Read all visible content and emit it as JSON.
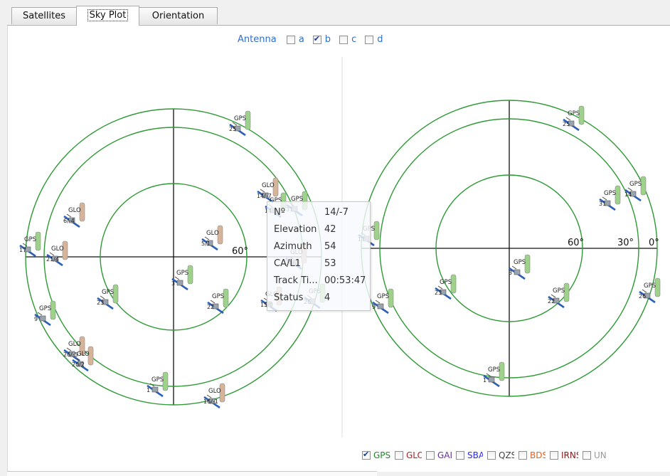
{
  "tabs": [
    {
      "label": "Satellites",
      "active": false
    },
    {
      "label": "Sky Plot",
      "active": true
    },
    {
      "label": "Orientation",
      "active": false
    }
  ],
  "antenna": {
    "label": "Antenna",
    "options": [
      {
        "label": "a",
        "checked": false
      },
      {
        "label": "b",
        "checked": true
      },
      {
        "label": "c",
        "checked": false
      },
      {
        "label": "d",
        "checked": false
      }
    ]
  },
  "plot": {
    "elevation_labels": [
      "60°",
      "30°",
      "0°"
    ],
    "ring_color": "#2e9a35",
    "colors": {
      "GPS": "#9ed18a",
      "GLO": "#d6b49a"
    }
  },
  "left_satellites": [
    {
      "sys": "GPS",
      "id": "25"
    },
    {
      "sys": "GLO",
      "id": "14/-7"
    },
    {
      "sys": "GPS",
      "id": "31"
    },
    {
      "sys": "GPS",
      "id": "14"
    },
    {
      "sys": "GLO",
      "id": "6/-4"
    },
    {
      "sys": "GPS",
      "id": "17"
    },
    {
      "sys": "GLO",
      "id": "21/4"
    },
    {
      "sys": "GLO",
      "id": "5/1"
    },
    {
      "sys": "GLO",
      "id": "30/-3"
    },
    {
      "sys": "GPS",
      "id": "3"
    },
    {
      "sys": "GPS",
      "id": "23"
    },
    {
      "sys": "GPS",
      "id": "22"
    },
    {
      "sys": "GLO",
      "id": "15/0"
    },
    {
      "sys": "GPS",
      "id": "26"
    },
    {
      "sys": "GPS",
      "id": "9"
    },
    {
      "sys": "GLO",
      "id": "26/-5"
    },
    {
      "sys": "GLO",
      "id": "20/2"
    },
    {
      "sys": "GPS",
      "id": "1"
    },
    {
      "sys": "GLO",
      "id": "16/-1"
    }
  ],
  "right_satellites": [
    {
      "sys": "GPS",
      "id": "25"
    },
    {
      "sys": "GPS",
      "id": "31"
    },
    {
      "sys": "GPS",
      "id": "14"
    },
    {
      "sys": "GPS",
      "id": "17"
    },
    {
      "sys": "GPS",
      "id": "3"
    },
    {
      "sys": "GPS",
      "id": "23"
    },
    {
      "sys": "GPS",
      "id": "22"
    },
    {
      "sys": "GPS",
      "id": "9"
    },
    {
      "sys": "GPS",
      "id": "26"
    },
    {
      "sys": "GPS",
      "id": "1"
    }
  ],
  "tooltip": {
    "rows": [
      {
        "key": "Nº",
        "value": "14/-7"
      },
      {
        "key": "Elevation",
        "value": "42"
      },
      {
        "key": "Azimuth",
        "value": "54"
      },
      {
        "key": "CA/L1",
        "value": "53"
      },
      {
        "key": "Track Ti...",
        "value": "00:53:47"
      },
      {
        "key": "Status",
        "value": "4"
      }
    ]
  },
  "constellations": [
    {
      "label": "GPS",
      "checked": true,
      "color": "#1f8a2a"
    },
    {
      "label": "GLO",
      "checked": false,
      "color": "#b22222"
    },
    {
      "label": "GAL",
      "checked": false,
      "color": "#6a2fa0"
    },
    {
      "label": "SBAS",
      "checked": false,
      "color": "#2a2ae0"
    },
    {
      "label": "QZSS",
      "checked": false,
      "color": "#444444"
    },
    {
      "label": "BDS",
      "checked": false,
      "color": "#e8601c"
    },
    {
      "label": "IRNSS",
      "checked": false,
      "color": "#8a1a1a"
    },
    {
      "label": "UN",
      "checked": false,
      "color": "#9a9a9a"
    }
  ]
}
